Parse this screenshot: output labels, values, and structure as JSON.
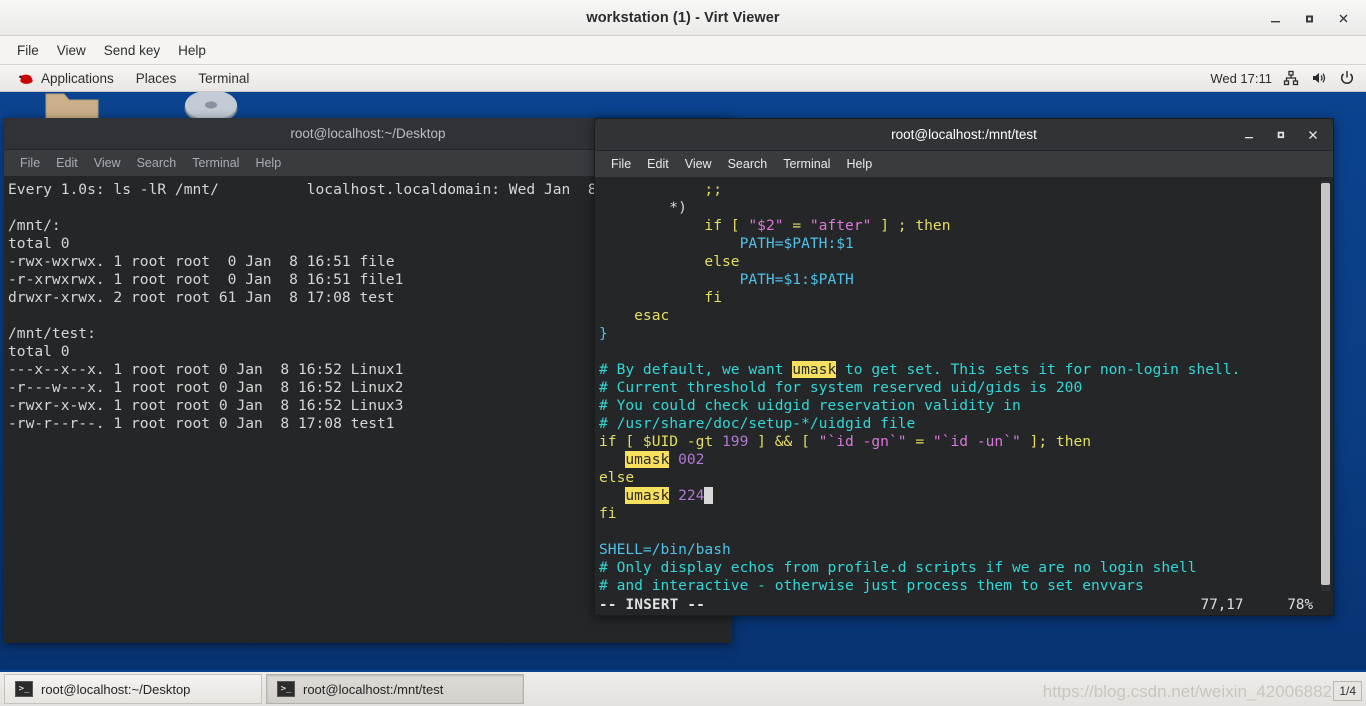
{
  "viewer": {
    "title": "workstation (1) - Virt Viewer",
    "window_buttons": [
      {
        "name": "minimize",
        "glyph": "–"
      },
      {
        "name": "maximize",
        "glyph": "□"
      },
      {
        "name": "close",
        "glyph": "✕"
      }
    ],
    "menu": [
      "File",
      "View",
      "Send key",
      "Help"
    ]
  },
  "panel": {
    "items": [
      "Applications",
      "Places",
      "Terminal"
    ],
    "clock": "Wed 17:11",
    "tray_icons": [
      "network-icon",
      "volume-icon",
      "power-icon"
    ]
  },
  "terminal_left": {
    "title": "root@localhost:~/Desktop",
    "menu": [
      "File",
      "Edit",
      "View",
      "Search",
      "Terminal",
      "Help"
    ],
    "lines": [
      "Every 1.0s: ls -lR /mnt/          localhost.localdomain: Wed Jan  8",
      "",
      "/mnt/:",
      "total 0",
      "-rwx-wxrwx. 1 root root  0 Jan  8 16:51 file",
      "-r-xrwxrwx. 1 root root  0 Jan  8 16:51 file1",
      "drwxr-xrwx. 2 root root 61 Jan  8 17:08 test",
      "",
      "/mnt/test:",
      "total 0",
      "---x--x--x. 1 root root 0 Jan  8 16:52 Linux1",
      "-r---w---x. 1 root root 0 Jan  8 16:52 Linux2",
      "-rwxr-x-wx. 1 root root 0 Jan  8 16:52 Linux3",
      "-rw-r--r--. 1 root root 0 Jan  8 17:08 test1"
    ]
  },
  "terminal_right": {
    "title": "root@localhost:/mnt/test",
    "menu": [
      "File",
      "Edit",
      "View",
      "Search",
      "Terminal",
      "Help"
    ],
    "window_buttons": [
      {
        "name": "minimize",
        "glyph": "–"
      },
      {
        "name": "maximize",
        "glyph": "□"
      },
      {
        "name": "close",
        "glyph": "✕"
      }
    ],
    "editor": {
      "code_lines": [
        [
          {
            "t": "            ;;",
            "c": "c-punct"
          }
        ],
        [
          {
            "t": "        *)",
            "c": "c-plain"
          }
        ],
        [
          {
            "t": "            if [ ",
            "c": "c-key"
          },
          {
            "t": "\"$2\"",
            "c": "c-str"
          },
          {
            "t": " = ",
            "c": "c-key"
          },
          {
            "t": "\"after\"",
            "c": "c-str"
          },
          {
            "t": " ] ; then",
            "c": "c-key"
          }
        ],
        [
          {
            "t": "                PATH=$PATH:$1",
            "c": "c-var"
          }
        ],
        [
          {
            "t": "            else",
            "c": "c-key"
          }
        ],
        [
          {
            "t": "                PATH=$1:$PATH",
            "c": "c-var"
          }
        ],
        [
          {
            "t": "            fi",
            "c": "c-key"
          }
        ],
        [
          {
            "t": "    esac",
            "c": "c-key"
          }
        ],
        [
          {
            "t": "}",
            "c": "c-var"
          }
        ],
        [
          {
            "t": "",
            "c": "c-plain"
          }
        ],
        [
          {
            "t": "# By default, we want ",
            "c": "c-cmt"
          },
          {
            "t": "umask",
            "c": "hl-umask"
          },
          {
            "t": " to get set. This sets it for non-login shell.",
            "c": "c-cmt"
          }
        ],
        [
          {
            "t": "# Current threshold for system reserved uid/gids is 200",
            "c": "c-cmt"
          }
        ],
        [
          {
            "t": "# You could check uidgid reservation validity in",
            "c": "c-cmt"
          }
        ],
        [
          {
            "t": "# /usr/share/doc/setup-*/uidgid file",
            "c": "c-cmt"
          }
        ],
        [
          {
            "t": "if [ $UID -gt ",
            "c": "c-key"
          },
          {
            "t": "199",
            "c": "c-num"
          },
          {
            "t": " ] && [ ",
            "c": "c-key"
          },
          {
            "t": "\"`id -gn`\"",
            "c": "c-str"
          },
          {
            "t": " = ",
            "c": "c-key"
          },
          {
            "t": "\"`id -un`\"",
            "c": "c-str"
          },
          {
            "t": " ]; then",
            "c": "c-key"
          }
        ],
        [
          {
            "t": "   ",
            "c": "c-plain"
          },
          {
            "t": "umask",
            "c": "hl-umask"
          },
          {
            "t": " ",
            "c": "c-plain"
          },
          {
            "t": "002",
            "c": "c-num"
          }
        ],
        [
          {
            "t": "else",
            "c": "c-key"
          }
        ],
        [
          {
            "t": "   ",
            "c": "c-plain"
          },
          {
            "t": "umask",
            "c": "hl-umask"
          },
          {
            "t": " ",
            "c": "c-plain"
          },
          {
            "t": "224",
            "c": "c-num"
          },
          {
            "t": " ",
            "c": "vim-cursor"
          }
        ],
        [
          {
            "t": "fi",
            "c": "c-key"
          }
        ],
        [
          {
            "t": "",
            "c": "c-plain"
          }
        ],
        [
          {
            "t": "SHELL=/bin/bash",
            "c": "c-var"
          }
        ],
        [
          {
            "t": "# Only display echos from profile.d scripts if we are no login shell",
            "c": "c-cmt"
          }
        ],
        [
          {
            "t": "# and interactive - otherwise just process them to set envvars",
            "c": "c-cmt"
          }
        ]
      ],
      "status_mode": "-- INSERT --",
      "status_position": "77,17",
      "status_percent": "78%"
    }
  },
  "taskbar": {
    "buttons": [
      {
        "label": "root@localhost:~/Desktop",
        "icon": "terminal-icon",
        "pressed": false
      },
      {
        "label": "root@localhost:/mnt/test",
        "icon": "terminal-icon",
        "pressed": true
      }
    ],
    "watermark": "https://blog.csdn.net/weixin_42006882",
    "workspace": "1/4"
  }
}
